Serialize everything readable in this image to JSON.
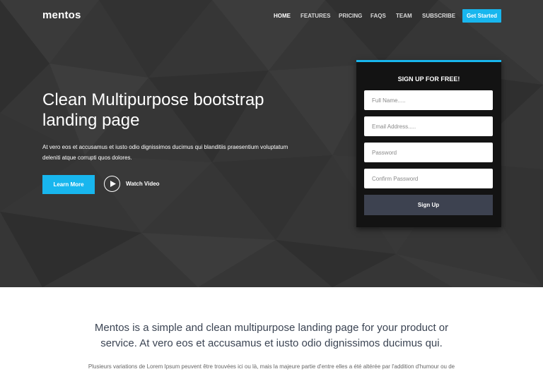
{
  "nav": {
    "logo": "mentos",
    "links": [
      "HOME",
      "FEATURES",
      "PRICING",
      "FAQS",
      "TEAM",
      "SUBSCRIBE"
    ],
    "active_link": "HOME",
    "cta_label": "Get Started"
  },
  "hero": {
    "title": "Clean Multipurpose bootstrap landing page",
    "text": "At vero eos et accusamus et iusto odio dignissimos ducimus qui blanditiis praesentium voluptatum deleniti atque corrupti quos dolores.",
    "learn_more_label": "Learn More",
    "watch_video_label": "Watch Video"
  },
  "signup": {
    "title": "SIGN UP FOR FREE!",
    "full_name_placeholder": "Full Name.....",
    "email_placeholder": "Email Address.....",
    "password_placeholder": "Password",
    "confirm_password_placeholder": "Confirm Password",
    "submit_label": "Sign Up"
  },
  "intro": {
    "heading": "Mentos is a simple and clean multipurpose landing page for your product or service. At vero eos et accusamus et iusto odio dignissimos ducimus qui.",
    "text": "Plusieurs variations de Lorem Ipsum peuvent être trouvées ici ou là, mais la majeure partie d'entre elles a été altérée par l'addition d'humour ou de"
  },
  "colors": {
    "accent": "#18b6ee",
    "hero_background": "#363636",
    "card_background": "#131313",
    "signup_button": "#3d4250",
    "heading_text": "#3b4453"
  }
}
